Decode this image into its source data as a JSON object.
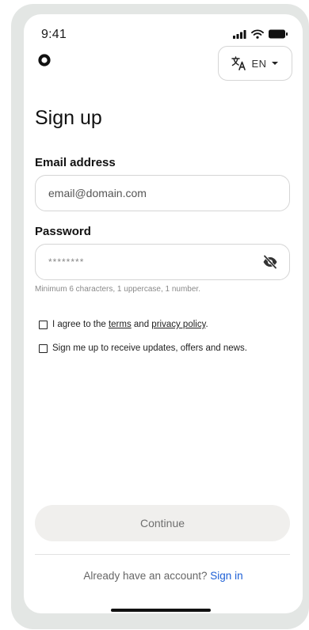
{
  "status_bar": {
    "time": "9:41",
    "icons": [
      "signal-icon",
      "wifi-icon",
      "battery-icon"
    ]
  },
  "header": {
    "logo": "app-logo",
    "language": {
      "icon": "translate-icon",
      "code": "EN",
      "chevron": "chevron-down-icon"
    }
  },
  "title": "Sign up",
  "email": {
    "label": "Email address",
    "value": "email@domain.com"
  },
  "password": {
    "label": "Password",
    "value": "********",
    "toggle_icon": "eye-off-icon",
    "hint": "Minimum 6 characters, 1 uppercase, 1 number."
  },
  "terms": {
    "prefix": "I agree to the ",
    "terms_link": "terms",
    "middle": " and ",
    "privacy_link": "privacy policy",
    "suffix": ".",
    "checked": false
  },
  "newsletter": {
    "label": "Sign me up to receive updates, offers and news.",
    "checked": false
  },
  "continue_label": "Continue",
  "footer": {
    "prompt": "Already have an account?",
    "signin_label": "Sign in"
  },
  "colors": {
    "frame": "#e3e6e4",
    "link": "#1d5fd6",
    "button_bg": "#f0efed"
  }
}
